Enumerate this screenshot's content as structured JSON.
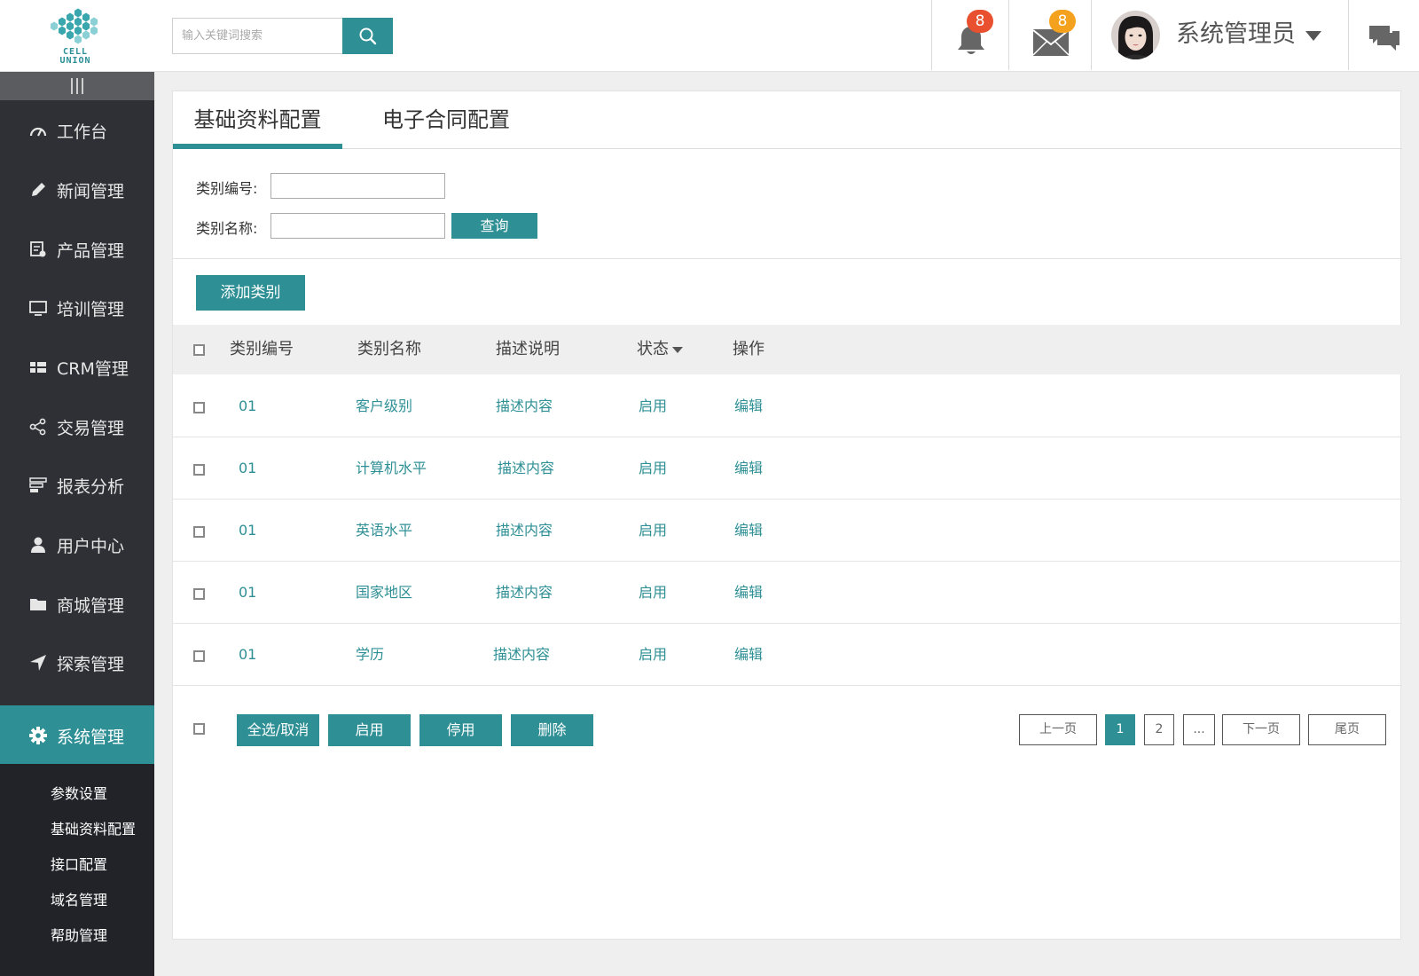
{
  "header": {
    "logo_text_1": "CELL",
    "logo_text_2": "UNION",
    "search_placeholder": "输入关键词搜索",
    "notification_count": "8",
    "message_count": "8",
    "user_name": "系统管理员",
    "accent_color": "#2e8f95",
    "notification_badge_color": "#e8502f",
    "message_badge_color": "#f4a21d"
  },
  "sidebar": {
    "items": [
      {
        "label": "工作台",
        "icon": "gauge-icon"
      },
      {
        "label": "新闻管理",
        "icon": "pencil-icon"
      },
      {
        "label": "产品管理",
        "icon": "product-list-icon"
      },
      {
        "label": "培训管理",
        "icon": "monitor-icon"
      },
      {
        "label": "CRM管理",
        "icon": "grid-icon"
      },
      {
        "label": "交易管理",
        "icon": "share-icon"
      },
      {
        "label": "报表分析",
        "icon": "report-icon"
      },
      {
        "label": "用户中心",
        "icon": "user-icon"
      },
      {
        "label": "商城管理",
        "icon": "folder-icon"
      },
      {
        "label": "探索管理",
        "icon": "navigation-icon"
      },
      {
        "label": "系统管理",
        "icon": "gear-icon",
        "active": true
      }
    ],
    "sub_items": [
      "参数设置",
      "基础资料配置",
      "接口配置",
      "域名管理",
      "帮助管理"
    ]
  },
  "tabs": [
    {
      "label": "基础资料配置",
      "active": true
    },
    {
      "label": "电子合同配置",
      "active": false
    }
  ],
  "filter": {
    "code_label": "类别编号:",
    "name_label": "类别名称:",
    "query_button": "查询"
  },
  "add_button": "添加类别",
  "table": {
    "headers": [
      "类别编号",
      "类别名称",
      "描述说明",
      "状态",
      "操作"
    ],
    "rows": [
      {
        "code": "01",
        "name": "客户级别",
        "desc": "描述内容",
        "status": "启用",
        "action": "编辑"
      },
      {
        "code": "01",
        "name": "计算机水平",
        "desc": "描述内容",
        "status": "启用",
        "action": "编辑"
      },
      {
        "code": "01",
        "name": "英语水平",
        "desc": "描述内容",
        "status": "启用",
        "action": "编辑"
      },
      {
        "code": "01",
        "name": "国家地区",
        "desc": "描述内容",
        "status": "启用",
        "action": "编辑"
      },
      {
        "code": "01",
        "name": "学历",
        "desc": "描述内容",
        "status": "启用",
        "action": "编辑"
      }
    ]
  },
  "bulk_actions": {
    "select_all": "全选/取消",
    "enable": "启用",
    "disable": "停用",
    "delete": "删除"
  },
  "pagination": {
    "prev": "上一页",
    "pages": [
      "1",
      "2",
      "..."
    ],
    "current": "1",
    "next": "下一页",
    "last": "尾页"
  }
}
